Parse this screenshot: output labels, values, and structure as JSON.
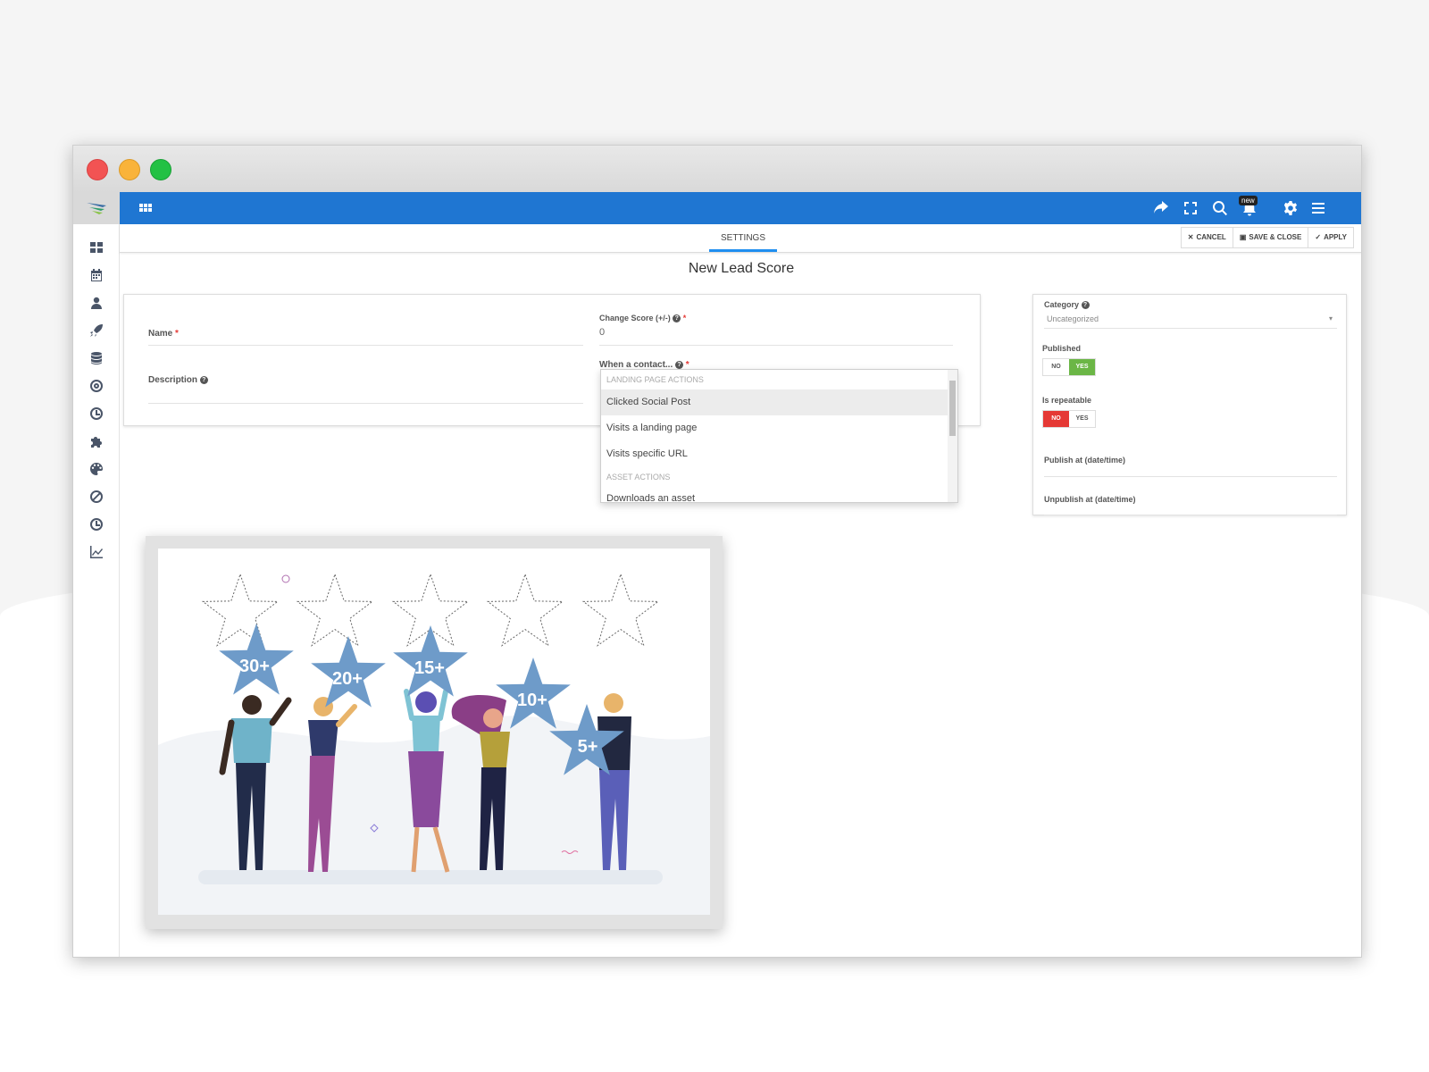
{
  "topbar": {
    "notification_badge": "new",
    "icons": [
      "apps-grid-icon",
      "share-icon",
      "fullscreen-icon",
      "search-icon",
      "bell-icon",
      "gear-icon",
      "menu-icon"
    ]
  },
  "sidebar": {
    "items": [
      "dashboard-icon",
      "calendar-icon",
      "user-icon",
      "rocket-icon",
      "database-icon",
      "target-icon",
      "clock-icon",
      "puzzle-icon",
      "palette-icon",
      "ban-icon",
      "history-icon",
      "chart-icon"
    ]
  },
  "tabs": {
    "settings": "SETTINGS"
  },
  "actions": {
    "cancel": "CANCEL",
    "save_close": "SAVE & CLOSE",
    "apply": "APPLY"
  },
  "page": {
    "title": "New Lead Score"
  },
  "form": {
    "name_label": "Name",
    "name_value": "",
    "description_label": "Description",
    "change_score_label": "Change Score (+/-)",
    "change_score_value": "0",
    "when_contact_label": "When a contact...",
    "required_mark": "*"
  },
  "dropdown": {
    "group1": "LANDING PAGE ACTIONS",
    "options1": [
      "Clicked Social Post",
      "Visits a landing page",
      "Visits specific URL"
    ],
    "group2": "ASSET ACTIONS",
    "options2": [
      "Downloads an asset"
    ],
    "selected": "Clicked Social Post"
  },
  "side_panel": {
    "category_label": "Category",
    "category_value": "Uncategorized",
    "published_label": "Published",
    "published": {
      "no": "NO",
      "yes": "YES",
      "value": "YES"
    },
    "repeatable_label": "Is repeatable",
    "repeatable": {
      "no": "NO",
      "yes": "YES",
      "value": "NO"
    },
    "publish_at_label": "Publish at (date/time)",
    "unpublish_at_label": "Unpublish at (date/time)"
  },
  "illustration": {
    "star_labels": [
      "30+",
      "20+",
      "15+",
      "10+",
      "5+"
    ]
  },
  "colors": {
    "topbar": "#1f76d2",
    "tab_underline": "#1f8ff0",
    "toggle_yes": "#6bb646",
    "toggle_no": "#e53935",
    "star": "#6e9bc9"
  }
}
